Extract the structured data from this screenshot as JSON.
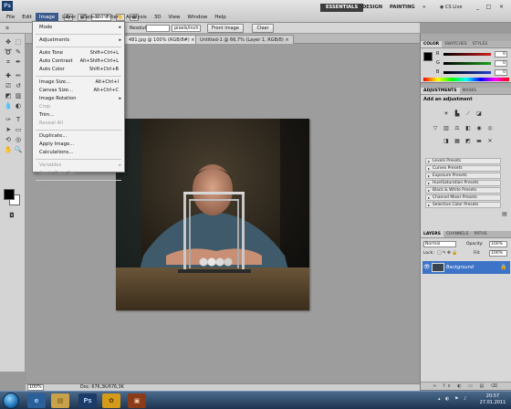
{
  "app": {
    "logo_text": "Ps",
    "menus": [
      "File",
      "Edit",
      "Image",
      "Layer",
      "Select",
      "Filter",
      "Analysis",
      "3D",
      "View",
      "Window",
      "Help"
    ],
    "active_menu": "Image",
    "zoom": "100%",
    "workspaces": [
      "ESSENTIALS",
      "DESIGN",
      "PAINTING"
    ],
    "active_workspace": "ESSENTIALS",
    "workspace_more": "»",
    "cs_live": "CS Live",
    "window_controls": [
      "_",
      "□",
      "×"
    ]
  },
  "options_bar": {
    "resolution_label": "Resolution:",
    "resolution_unit": "pixels/inch",
    "front_image_button": "Front Image",
    "clear_button": "Clear"
  },
  "doc_tabs": [
    {
      "label": "481.jpg @ 100% (RGB/8#) ×",
      "active": true
    },
    {
      "label": "Untitled-1 @ 66,7% (Layer 1, RGB/8) ×",
      "active": false
    }
  ],
  "image_menu": {
    "items": [
      {
        "label": "Mode",
        "shortcut": "",
        "submenu": true,
        "disabled": false
      },
      {
        "separator": true
      },
      {
        "label": "Adjustments",
        "shortcut": "",
        "submenu": true,
        "disabled": false
      },
      {
        "separator": true
      },
      {
        "label": "Auto Tone",
        "shortcut": "Shift+Ctrl+L",
        "submenu": false,
        "disabled": false
      },
      {
        "label": "Auto Contrast",
        "shortcut": "Alt+Shift+Ctrl+L",
        "submenu": false,
        "disabled": false
      },
      {
        "label": "Auto Color",
        "shortcut": "Shift+Ctrl+B",
        "submenu": false,
        "disabled": false
      },
      {
        "separator": true
      },
      {
        "label": "Image Size...",
        "shortcut": "Alt+Ctrl+I",
        "submenu": false,
        "disabled": false
      },
      {
        "label": "Canvas Size...",
        "shortcut": "Alt+Ctrl+C",
        "submenu": false,
        "disabled": false
      },
      {
        "label": "Image Rotation",
        "shortcut": "",
        "submenu": true,
        "disabled": false
      },
      {
        "label": "Crop",
        "shortcut": "",
        "submenu": false,
        "disabled": true
      },
      {
        "label": "Trim...",
        "shortcut": "",
        "submenu": false,
        "disabled": false
      },
      {
        "label": "Reveal All",
        "shortcut": "",
        "submenu": false,
        "disabled": true
      },
      {
        "separator": true
      },
      {
        "label": "Duplicate...",
        "shortcut": "",
        "submenu": false,
        "disabled": false
      },
      {
        "label": "Apply Image...",
        "shortcut": "",
        "submenu": false,
        "disabled": false
      },
      {
        "label": "Calculations...",
        "shortcut": "",
        "submenu": false,
        "disabled": false
      },
      {
        "separator": true
      },
      {
        "label": "Variables",
        "shortcut": "",
        "submenu": true,
        "disabled": true
      },
      {
        "label": "Apply Data Set...",
        "shortcut": "",
        "submenu": false,
        "disabled": true
      },
      {
        "separator": true
      },
      {
        "label": "Trap...",
        "shortcut": "",
        "submenu": false,
        "disabled": true
      }
    ]
  },
  "status_bar": {
    "zoom": "100%",
    "doc_info": "Doc: 676,3K/676,3K"
  },
  "color_panel": {
    "tabs": [
      "COLOR",
      "SWATCHES",
      "STYLES"
    ],
    "sliders": [
      {
        "letter": "R",
        "value": "0",
        "color": "#d02020"
      },
      {
        "letter": "G",
        "value": "0",
        "color": "#20a020"
      },
      {
        "letter": "B",
        "value": "0",
        "color": "#2040d0"
      }
    ]
  },
  "adjustments_panel": {
    "tabs": [
      "ADJUSTMENTS",
      "MASKS"
    ],
    "heading": "Add an adjustment",
    "presets": [
      "Levels Presets",
      "Curves Presets",
      "Exposure Presets",
      "Hue/Saturation Presets",
      "Black & White Presets",
      "Channel Mixer Presets",
      "Selective Color Presets"
    ]
  },
  "layers_panel": {
    "tabs": [
      "LAYERS",
      "CHANNELS",
      "PATHS"
    ],
    "blend_mode": "Normal",
    "opacity_label": "Opacity:",
    "opacity_value": "100%",
    "lock_label": "Lock:",
    "fill_label": "Fill:",
    "fill_value": "100%",
    "layer_name": "Background",
    "footer_icons": "∞ fx ◐ ▭ ▤ ⌫"
  },
  "taskbar": {
    "ps_label": "Ps",
    "clock_time": "20:57",
    "clock_date": "27.01.2011"
  }
}
